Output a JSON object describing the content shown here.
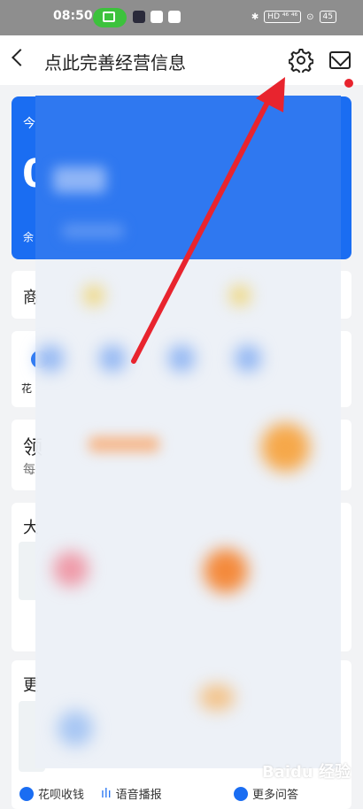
{
  "status_bar": {
    "time": "08:50",
    "indicators": "HD ⁴⁶ ⁴⁶",
    "battery": "45"
  },
  "nav": {
    "title": "点此完善经营信息"
  },
  "card": {
    "label": "今",
    "big": "0",
    "small": "余"
  },
  "sections": {
    "merchant": "商",
    "huabei": "花",
    "receive_title": "领",
    "receive_sub": "每",
    "big": "大",
    "more": "更"
  },
  "bottom": {
    "huabei_collect": "花呗收钱",
    "voice_broadcast": "语音播报",
    "more_qa": "更多问答"
  },
  "watermark": "Baidu 经验",
  "colors": {
    "accent": "#1a6df2",
    "arrow": "#e8242e"
  }
}
